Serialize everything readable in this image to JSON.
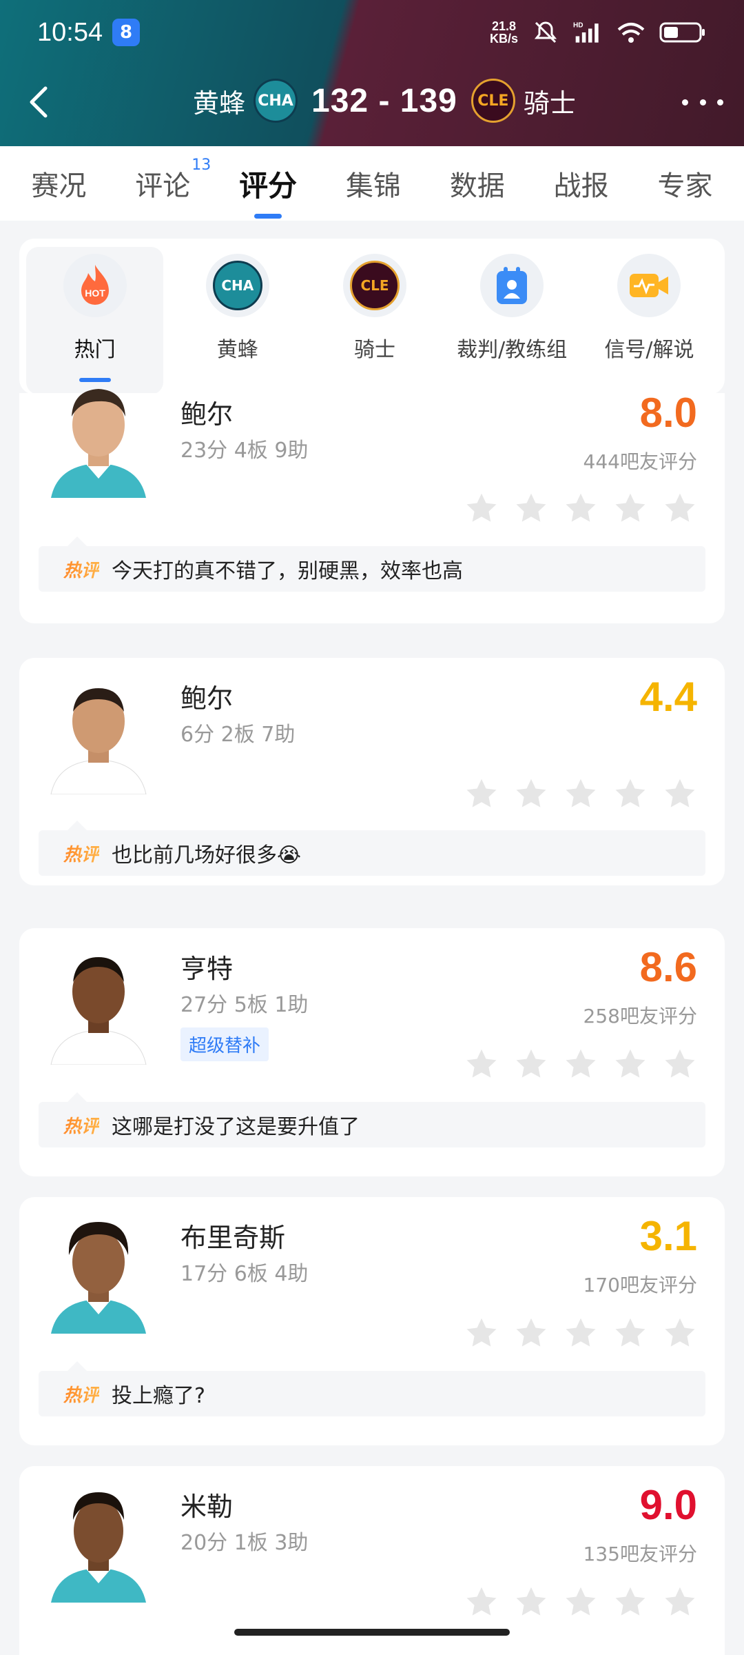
{
  "status": {
    "time": "10:54",
    "notif_icon": "8",
    "net_speed_value": "21.8",
    "net_speed_unit": "KB/s",
    "hd_label": "HD",
    "battery_icon": "battery-icon"
  },
  "game": {
    "home_team": "黄蜂",
    "home_abbr": "CHA",
    "score": "132 - 139",
    "away_abbr": "CLE",
    "away_team": "骑士"
  },
  "tabs": [
    {
      "label": "赛况"
    },
    {
      "label": "评论",
      "badge": "13"
    },
    {
      "label": "评分"
    },
    {
      "label": "集锦"
    },
    {
      "label": "数据"
    },
    {
      "label": "战报"
    },
    {
      "label": "专家"
    }
  ],
  "filters": [
    {
      "label": "热门",
      "icon_text": "HOT"
    },
    {
      "label": "黄蜂",
      "icon_text": "CHA"
    },
    {
      "label": "骑士",
      "icon_text": "CLE"
    },
    {
      "label": "裁判/教练组"
    },
    {
      "label": "信号/解说"
    }
  ],
  "hot_tag": "热评",
  "players": [
    {
      "name": "鲍尔",
      "stats": "23分 4板 9助",
      "rating": "8.0",
      "rating_color": "#f26a1f",
      "raters": "444吧友评分",
      "comment": "今天打的真不错了，别硬黑，效率也高",
      "jersey": "#3fb8c4"
    },
    {
      "name": "鲍尔",
      "stats": "6分 2板 7助",
      "rating": "4.4",
      "rating_color": "#f5b400",
      "raters": "",
      "comment": "也比前几场好很多😭",
      "jersey": "#ffffff"
    },
    {
      "name": "亨特",
      "stats": "27分 5板 1助",
      "badge": "超级替补",
      "rating": "8.6",
      "rating_color": "#f26a1f",
      "raters": "258吧友评分",
      "comment": "这哪是打没了这是要升值了",
      "jersey": "#ffffff"
    },
    {
      "name": "布里奇斯",
      "stats": "17分 6板 4助",
      "rating": "3.1",
      "rating_color": "#f5b400",
      "raters": "170吧友评分",
      "comment": "投上瘾了?",
      "jersey": "#3fb8c4"
    },
    {
      "name": "米勒",
      "stats": "20分 1板 3助",
      "rating": "9.0",
      "rating_color": "#e0102f",
      "raters": "135吧友评分",
      "comment": "",
      "jersey": "#3fb8c4"
    }
  ]
}
